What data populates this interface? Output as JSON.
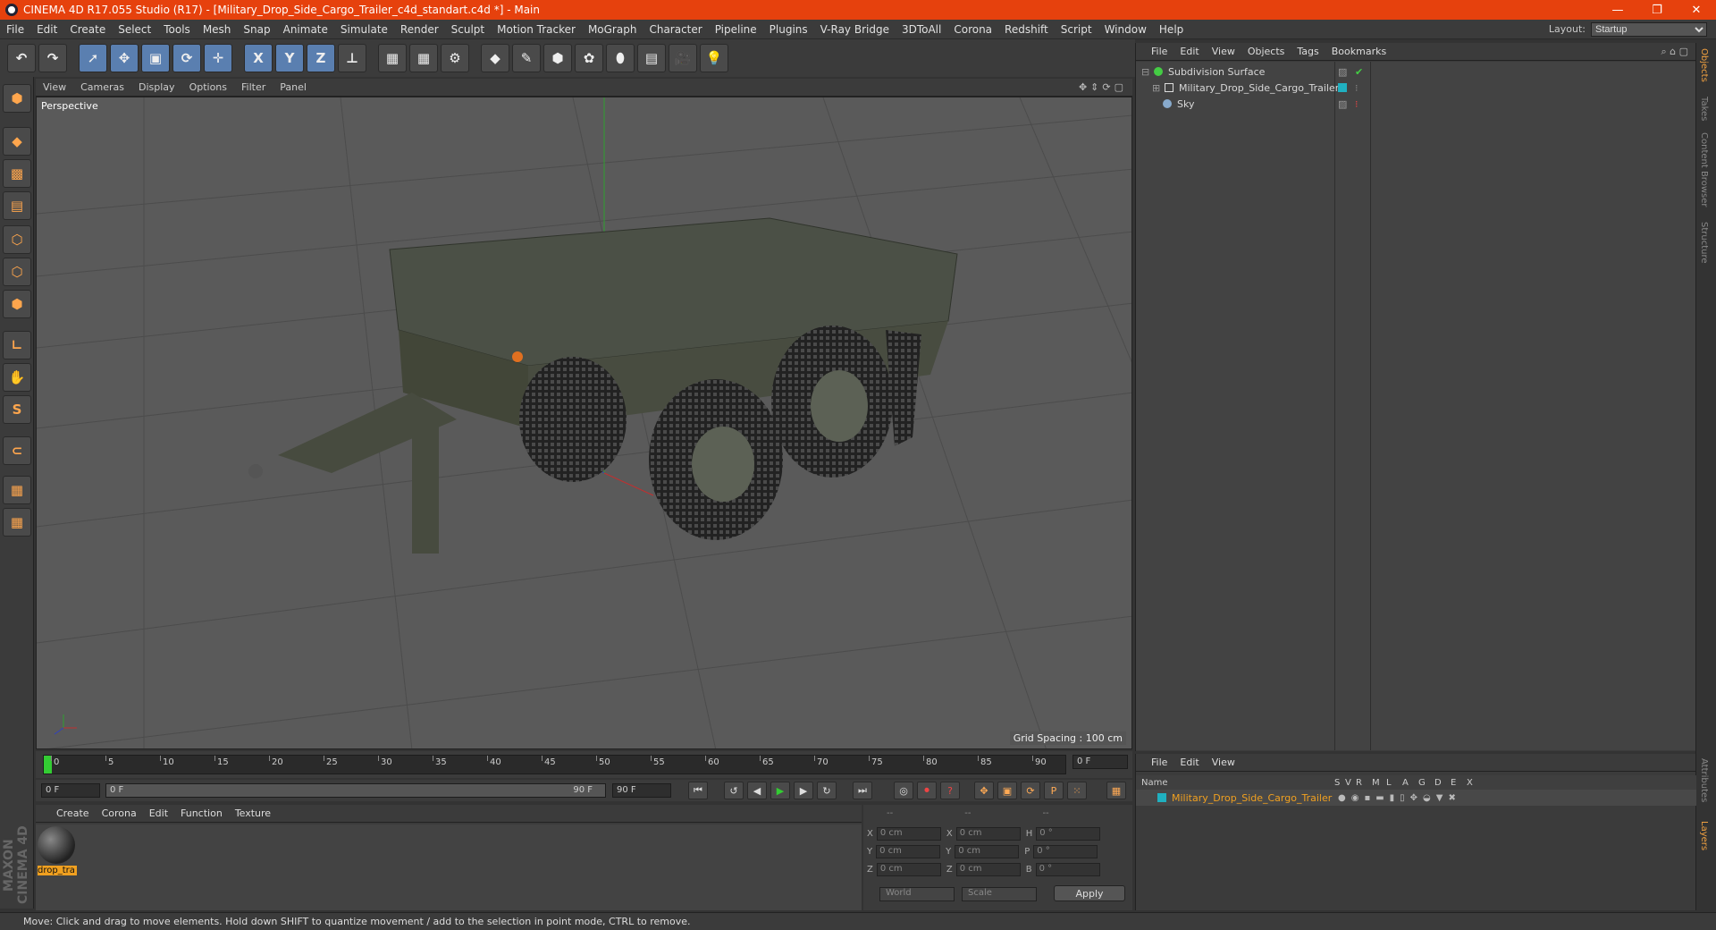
{
  "window": {
    "title": "CINEMA 4D R17.055 Studio (R17) - [Military_Drop_Side_Cargo_Trailer_c4d_standart.c4d *] - Main",
    "minimize": "—",
    "restore": "❐",
    "close": "✕"
  },
  "menu": [
    "File",
    "Edit",
    "Create",
    "Select",
    "Tools",
    "Mesh",
    "Snap",
    "Animate",
    "Simulate",
    "Render",
    "Sculpt",
    "Motion Tracker",
    "MoGraph",
    "Character",
    "Pipeline",
    "Plugins",
    "V-Ray Bridge",
    "3DToAll",
    "Corona",
    "Redshift",
    "Script",
    "Window",
    "Help"
  ],
  "layout": {
    "label": "Layout:",
    "value": "Startup"
  },
  "toolbar": {
    "x": "X",
    "y": "Y",
    "z": "Z"
  },
  "viewport": {
    "menu": [
      "View",
      "Cameras",
      "Display",
      "Options",
      "Filter",
      "Panel"
    ],
    "label": "Perspective",
    "grid_spacing": "Grid Spacing : 100 cm"
  },
  "objects": {
    "menu": [
      "File",
      "Edit",
      "View",
      "Objects",
      "Tags",
      "Bookmarks"
    ],
    "items": [
      {
        "name": "Subdivision Surface",
        "color": "#44cc44"
      },
      {
        "name": "Military_Drop_Side_Cargo_Trailer",
        "color": "#ffffff"
      },
      {
        "name": "Sky",
        "color": "#88aacc"
      }
    ]
  },
  "side_tabs": [
    "Objects",
    "Takes",
    "Content Browser",
    "Structure",
    "Attributes",
    "Layers"
  ],
  "timeline": {
    "ticks": [
      "0",
      "5",
      "10",
      "15",
      "20",
      "25",
      "30",
      "35",
      "40",
      "45",
      "50",
      "55",
      "60",
      "65",
      "70",
      "75",
      "80",
      "85",
      "90"
    ],
    "frame_end_field": "0 F"
  },
  "playback": {
    "start": "0 F",
    "range_start": "0 F",
    "range_end": "90 F",
    "end": "90 F"
  },
  "materials": {
    "menu": [
      "Create",
      "Corona",
      "Edit",
      "Function",
      "Texture"
    ],
    "items": [
      {
        "name": "drop_tra"
      }
    ]
  },
  "coords": {
    "headers": [
      "--",
      "--",
      "--"
    ],
    "rows": [
      {
        "a": "X",
        "av": "0 cm",
        "b": "X",
        "bv": "0 cm",
        "c": "H",
        "cv": "0 °"
      },
      {
        "a": "Y",
        "av": "0 cm",
        "b": "Y",
        "bv": "0 cm",
        "c": "P",
        "cv": "0 °"
      },
      {
        "a": "Z",
        "av": "0 cm",
        "b": "Z",
        "bv": "0 cm",
        "c": "B",
        "cv": "0 °"
      }
    ],
    "world": "World",
    "scale": "Scale",
    "apply": "Apply"
  },
  "layers": {
    "menu": [
      "File",
      "Edit",
      "View"
    ],
    "name_header": "Name",
    "cols": [
      "S",
      "V",
      "R",
      "M",
      "L",
      "A",
      "G",
      "D",
      "E",
      "X"
    ],
    "row": "Military_Drop_Side_Cargo_Trailer",
    "row_color": "#f0a020"
  },
  "status": "Move: Click and drag to move elements. Hold down SHIFT to quantize movement / add to the selection in point mode, CTRL to remove.",
  "brand": "MAXON CINEMA 4D"
}
